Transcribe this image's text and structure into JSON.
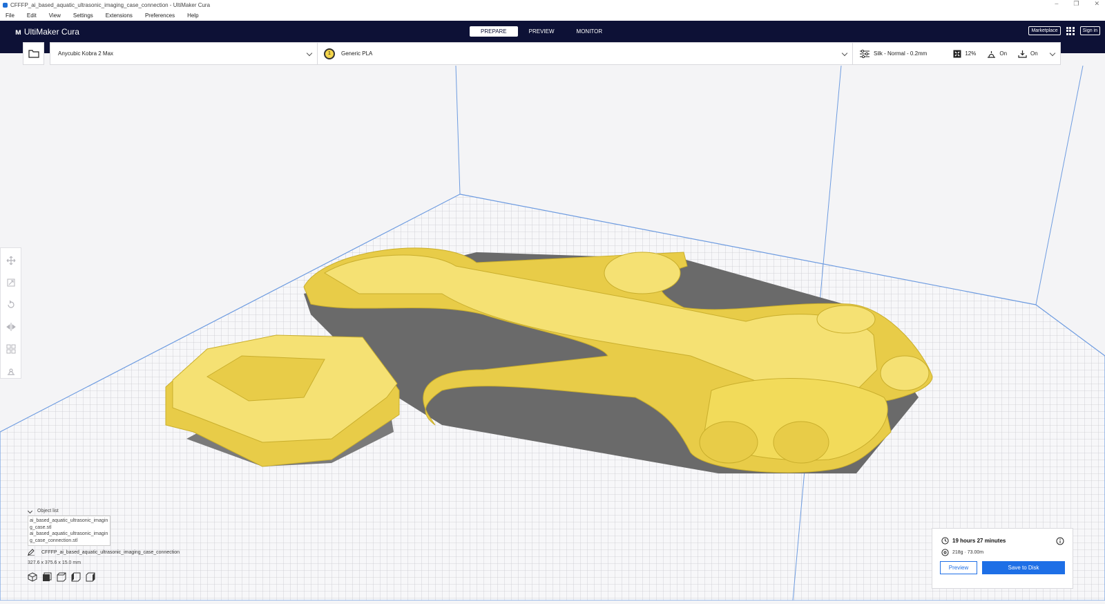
{
  "window": {
    "title": "CFFFP_ai_based_aquatic_ultrasonic_imaging_case_connection - UltiMaker Cura",
    "controls": [
      "–",
      "❐",
      "✕"
    ]
  },
  "menu": [
    "File",
    "Edit",
    "View",
    "Settings",
    "Extensions",
    "Preferences",
    "Help"
  ],
  "header": {
    "logo": "UltiMaker Cura",
    "stages": [
      "PREPARE",
      "PREVIEW",
      "MONITOR"
    ],
    "active_stage": "PREPARE",
    "marketplace": "Marketplace",
    "sign_in": "Sign in"
  },
  "toolbar": {
    "printer": "Anycubic Kobra 2 Max",
    "extruder_number": "1",
    "material": "Generic PLA",
    "profile": "Silk - Normal - 0.2mm",
    "infill": "12%",
    "support": "On",
    "adhesion": "On"
  },
  "object_list": {
    "title": "Object list",
    "items": [
      "ai_based_aquatic_ultrasonic_imaging_case.stl",
      "ai_based_aquatic_ultrasonic_imaging_case_connection.stl"
    ]
  },
  "project": {
    "name": "CFFFP_ai_based_aquatic_ultrasonic_imaging_case_connection",
    "dimensions": "327.6 x 375.6 x 15.0 mm"
  },
  "print_info": {
    "time": "19 hours 27 minutes",
    "material": "218g · 73.00m",
    "preview_label": "Preview",
    "save_label": "Save to Disk"
  },
  "colors": {
    "header_bg": "#0d1136",
    "accent": "#1e6fe6",
    "model_yellow": "#f2db5a",
    "shadow": "#6a6a6a"
  }
}
